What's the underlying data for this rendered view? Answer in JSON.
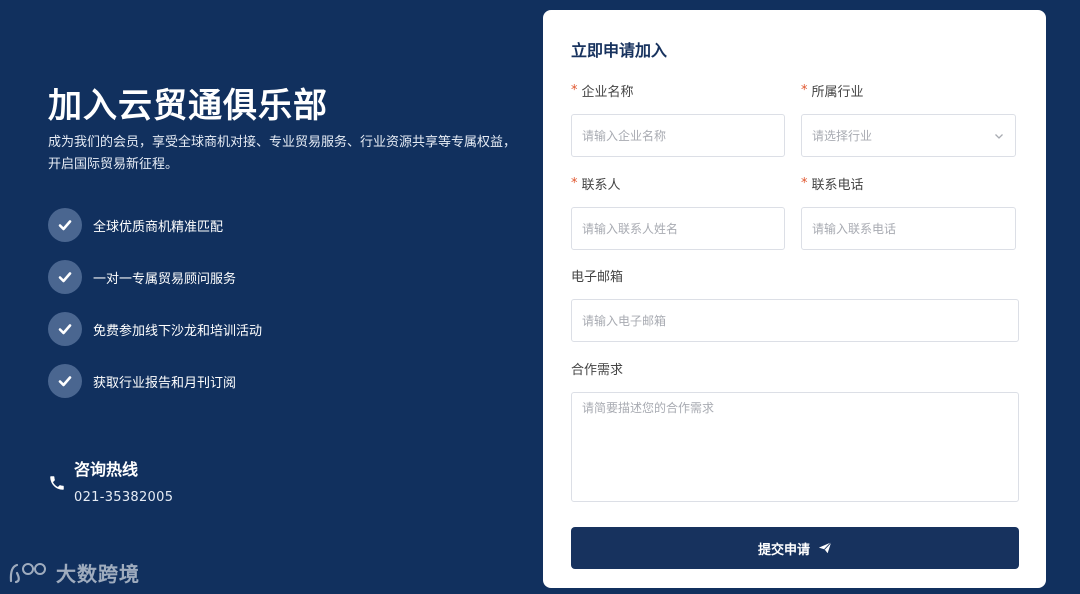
{
  "hero": {
    "title": "加入云贸通俱乐部",
    "description": "成为我们的会员，享受全球商机对接、专业贸易服务、行业资源共享等专属权益，开启国际贸易新征程。"
  },
  "benefits": [
    {
      "label": "全球优质商机精准匹配",
      "icon": "check-icon"
    },
    {
      "label": "一对一专属贸易顾问服务",
      "icon": "check-icon"
    },
    {
      "label": "免费参加线下沙龙和培训活动",
      "icon": "check-icon"
    },
    {
      "label": "获取行业报告和月刊订阅",
      "icon": "check-icon"
    }
  ],
  "hotline": {
    "title": "咨询热线",
    "number": "021-35382005",
    "icon": "phone-icon"
  },
  "watermark": {
    "text": "大数跨境"
  },
  "form": {
    "title": "立即申请加入",
    "required_mark": "*",
    "company": {
      "label": "企业名称",
      "placeholder": "请输入企业名称"
    },
    "industry": {
      "label": "所属行业",
      "placeholder": "请选择行业"
    },
    "contact": {
      "label": "联系人",
      "placeholder": "请输入联系人姓名"
    },
    "phone": {
      "label": "联系电话",
      "placeholder": "请输入联系电话"
    },
    "email": {
      "label": "电子邮箱",
      "placeholder": "请输入电子邮箱"
    },
    "needs": {
      "label": "合作需求",
      "placeholder": "请简要描述您的合作需求"
    },
    "submit_label": "提交申请"
  },
  "colors": {
    "background": "#11305e",
    "accent": "#17325e",
    "required": "#e0552d"
  }
}
